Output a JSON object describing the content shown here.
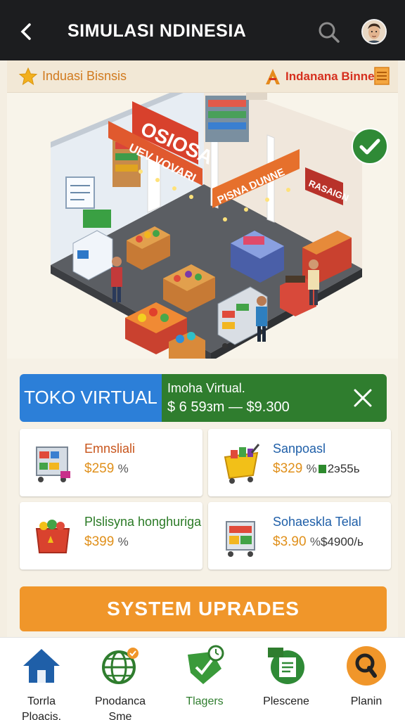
{
  "appbar": {
    "title": "SIMULASI NDINESIA"
  },
  "subheader": {
    "left_label": "Induasi Bisnsis",
    "right_label": "Indanana Binnes"
  },
  "banner": {
    "signs": [
      "OSIOSA",
      "UEV VOVARI",
      "PISNA DUNNE",
      "RASAIGN"
    ],
    "active_dot": 1,
    "dot_count": 3
  },
  "store": {
    "label": "TOKO VIRTUAL",
    "name": "Imoha Virtual.",
    "range": "$ 6 59зm — $9.300"
  },
  "items": [
    {
      "name": "Emnsliali",
      "name_color": "#c8551c",
      "price": "$259",
      "pct": "%",
      "extra": ""
    },
    {
      "name": "Sanpoasl",
      "name_color": "#1f5fa8",
      "price": "$329",
      "pct": "%",
      "extra": "2э55ь",
      "badge": true
    },
    {
      "name": "Plslisyna honghuriga",
      "name_color": "#2a7a25",
      "price": "$399",
      "pct": "%",
      "extra": ""
    },
    {
      "name": "Sohaeskla Telal",
      "name_color": "#1f5fa8",
      "price": "$3.90",
      "pct": "%",
      "extra": "$4900/ь"
    }
  ],
  "upgrade_label": "SYSTEM UPRADES",
  "nav": [
    {
      "label": "Torrla\nPloacis.",
      "icon": "home-icon"
    },
    {
      "label": "Pnodanca\nSme",
      "icon": "globe-icon"
    },
    {
      "label": "Tlagers",
      "icon": "shield-check-icon"
    },
    {
      "label": "Plescene",
      "icon": "document-icon"
    },
    {
      "label": "Planin",
      "icon": "magnifier-icon"
    }
  ],
  "colors": {
    "appbar": "#1c1d1f",
    "store_blue": "#2c7fd8",
    "store_green": "#2f7d2e",
    "upgrade": "#f0962a"
  }
}
